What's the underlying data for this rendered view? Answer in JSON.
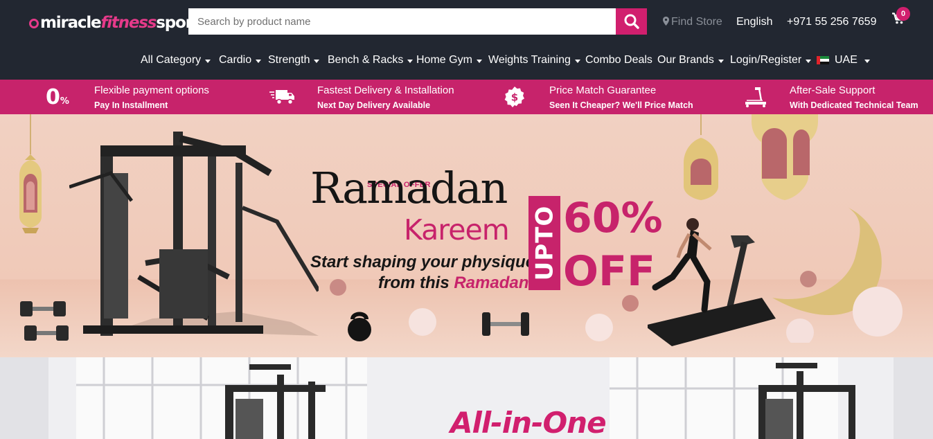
{
  "header": {
    "logo": {
      "part1": "miracle",
      "part2": "fitness",
      "part3": "sports"
    },
    "search": {
      "placeholder": "Search by product name"
    },
    "find_store": "Find Store",
    "language": "English",
    "phone": "+971 55 256 7659",
    "cart_count": "0"
  },
  "nav": {
    "items": [
      {
        "label": "All Category",
        "dropdown": true
      },
      {
        "label": "Cardio",
        "dropdown": true
      },
      {
        "label": "Strength",
        "dropdown": true
      },
      {
        "label": "Bench & Racks",
        "dropdown": true
      },
      {
        "label": "Home Gym",
        "dropdown": true
      },
      {
        "label": "Weights Training",
        "dropdown": true
      },
      {
        "label": "Combo Deals",
        "dropdown": false
      },
      {
        "label": "Our Brands",
        "dropdown": true
      },
      {
        "label": "Login/Register",
        "dropdown": true
      }
    ],
    "country": "UAE"
  },
  "features": [
    {
      "icon": "zero-percent-icon",
      "big": "0",
      "small": "%",
      "title": "Flexible payment options",
      "subtitle": "Pay In Installment"
    },
    {
      "icon": "delivery-truck-icon",
      "title": "Fastest Delivery & Installation",
      "subtitle": "Next Day Delivery Available"
    },
    {
      "icon": "price-match-icon",
      "title": "Price Match Guarantee",
      "subtitle": "Seen It Cheaper? We'll Price Match"
    },
    {
      "icon": "treadmill-icon",
      "title": "After-Sale Support",
      "subtitle": "With Dedicated Technical Team"
    }
  ],
  "banner": {
    "special_offer": "SPECIAL OFFER",
    "ramadan": "Ramadan",
    "kareem": "Kareem",
    "line1": "Start shaping your physique",
    "line2_prefix": "from this ",
    "line2_highlight": "Ramadan",
    "upto": "UPTO",
    "percent": "60%",
    "off": "OFF"
  },
  "banner2": {
    "headline": "All-in-One"
  },
  "colors": {
    "accent": "#c7236b",
    "header_bg": "#222731"
  }
}
